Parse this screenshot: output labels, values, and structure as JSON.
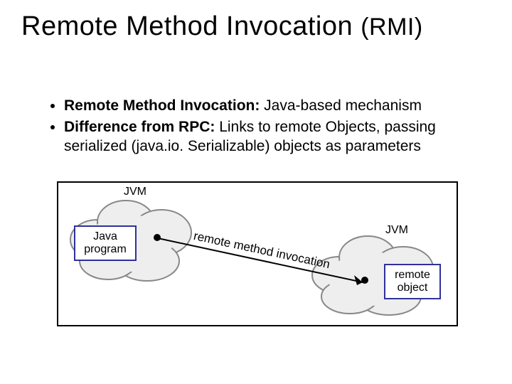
{
  "title_main": "Remote Method Invocation",
  "title_suffix": "(RMI)",
  "bullets": [
    {
      "bold": "Remote Method Invocation:",
      "rest": "  Java-based mechanism"
    },
    {
      "bold": "Difference from RPC:",
      "rest": " Links to remote Objects, passing serialized (java.io. Serializable) objects as parameters"
    }
  ],
  "diagram": {
    "jvm_label_left": "JVM",
    "jvm_label_right": "JVM",
    "left_box_line1": "Java",
    "left_box_line2": "program",
    "right_box_line1": "remote",
    "right_box_line2": "object",
    "edge_label": "remote method invocation"
  }
}
